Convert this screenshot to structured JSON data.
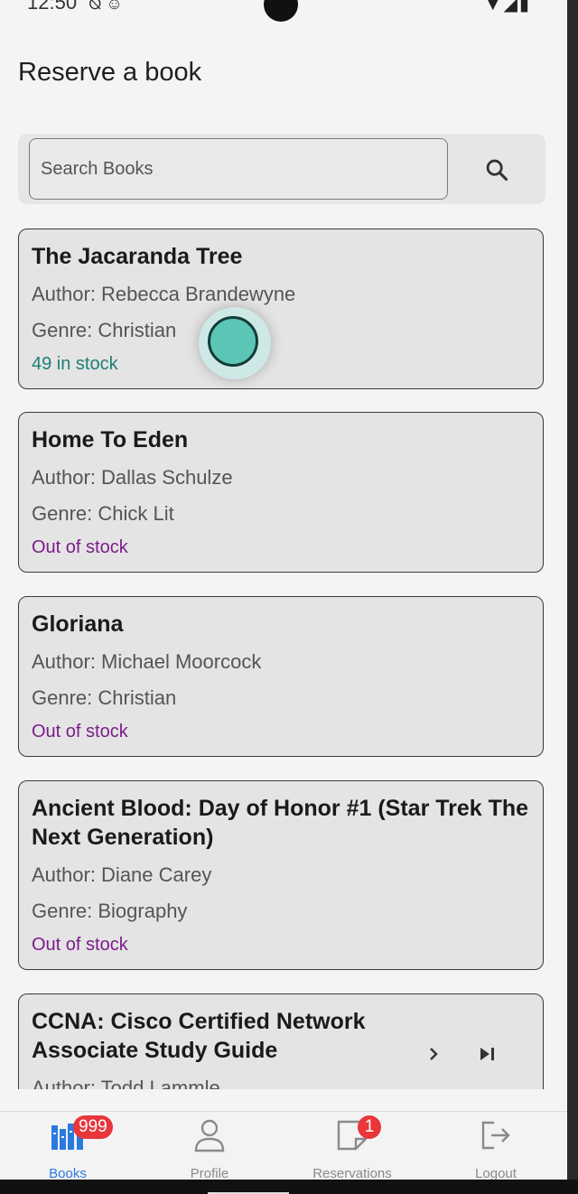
{
  "status_bar": {
    "time": "12:50",
    "left_icons": "⦰ ☺",
    "right_icons": "▼◢▮"
  },
  "header": {
    "title": "Reserve a book"
  },
  "search": {
    "placeholder": "Search Books"
  },
  "books": [
    {
      "title": "The Jacaranda Tree",
      "author": "Author: Rebecca Brandewyne",
      "genre": "Genre: Christian",
      "stock": "49 in stock",
      "in_stock": true
    },
    {
      "title": "Home To Eden",
      "author": "Author: Dallas Schulze",
      "genre": "Genre: Chick Lit",
      "stock": "Out of stock",
      "in_stock": false
    },
    {
      "title": "Gloriana",
      "author": "Author: Michael Moorcock",
      "genre": "Genre: Christian",
      "stock": "Out of stock",
      "in_stock": false
    },
    {
      "title": "Ancient Blood:  Day of Honor #1 (Star Trek The Next Generation)",
      "author": "Author: Diane Carey",
      "genre": "Genre: Biography",
      "stock": "Out of stock",
      "in_stock": false
    },
    {
      "title": "CCNA: Cisco Certified Network Associate Study Guide",
      "author": "Author: Todd Lammle",
      "genre": "",
      "stock": "",
      "in_stock": false
    }
  ],
  "nav": {
    "books": {
      "label": "Books",
      "badge": "999"
    },
    "profile": {
      "label": "Profile"
    },
    "reservations": {
      "label": "Reservations",
      "badge": "1"
    },
    "logout": {
      "label": "Logout"
    }
  },
  "colors": {
    "accent": "#2b7ae0",
    "in_stock": "#1f7f77",
    "out_of_stock": "#7b1c8a",
    "badge": "#e8363a"
  }
}
